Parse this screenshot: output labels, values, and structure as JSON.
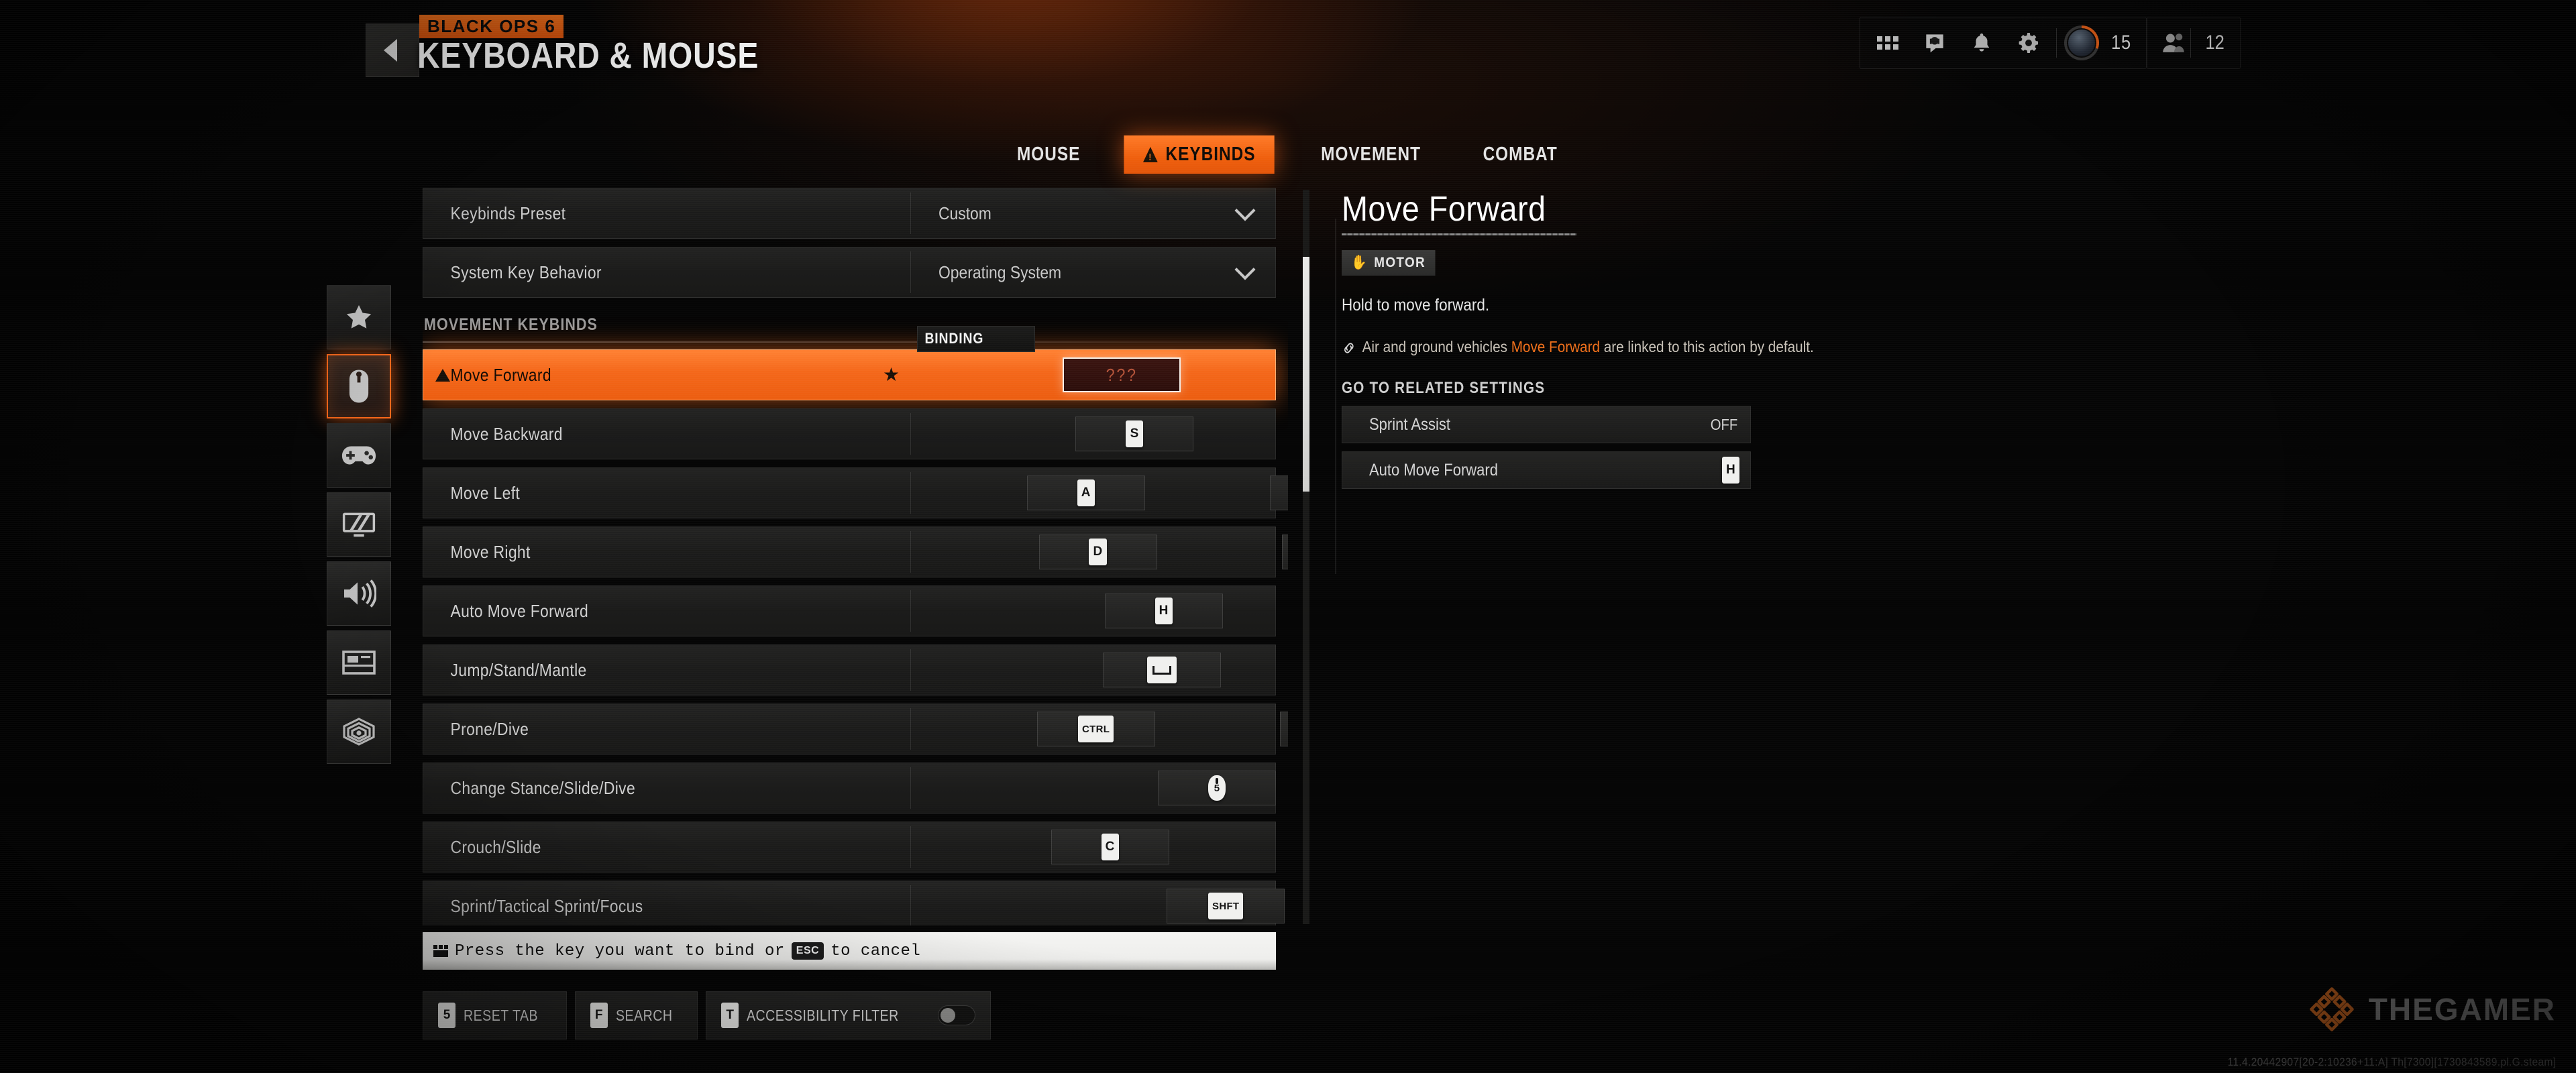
{
  "header": {
    "franchise_logo": "BLACK OPS 6",
    "title": "KEYBOARD & MOUSE",
    "back_icon": "chevron-left-icon"
  },
  "hud": {
    "icons": [
      "apps-grid-icon",
      "headset-icon",
      "bell-icon",
      "gear-icon"
    ],
    "level": "15",
    "friends_count": "12"
  },
  "tabs": [
    {
      "label": "MOUSE",
      "active": false,
      "warning": false
    },
    {
      "label": "KEYBINDS",
      "active": true,
      "warning": true
    },
    {
      "label": "MOVEMENT",
      "active": false,
      "warning": false
    },
    {
      "label": "COMBAT",
      "active": false,
      "warning": false
    }
  ],
  "sidebar": {
    "items": [
      {
        "name": "favorites",
        "icon": "star-icon",
        "active": false
      },
      {
        "name": "keyboard-mouse",
        "icon": "mouse-icon",
        "active": true
      },
      {
        "name": "controller",
        "icon": "gamepad-icon",
        "active": false
      },
      {
        "name": "graphics",
        "icon": "display-icon",
        "active": false
      },
      {
        "name": "audio",
        "icon": "speaker-icon",
        "active": false
      },
      {
        "name": "interface",
        "icon": "layout-icon",
        "active": false
      },
      {
        "name": "accessibility",
        "icon": "radar-icon",
        "active": false
      }
    ]
  },
  "settings_top": [
    {
      "label": "Keybinds Preset",
      "value": "Custom",
      "control": "dropdown"
    },
    {
      "label": "System Key Behavior",
      "value": "Operating System",
      "control": "dropdown"
    }
  ],
  "section_title": "MOVEMENT KEYBINDS",
  "binding_tooltip": "BINDING",
  "keybinds": [
    {
      "label": "Move Forward",
      "bind1": "???",
      "bind2": "",
      "selected": true,
      "warning": true,
      "favorite": true,
      "keytype1": "text"
    },
    {
      "label": "Move Backward",
      "bind1": "S",
      "bind2": "",
      "keytype1": "key"
    },
    {
      "label": "Move Left",
      "bind1": "A",
      "bind2": "",
      "keytype1": "key"
    },
    {
      "label": "Move Right",
      "bind1": "D",
      "bind2": "",
      "keytype1": "key"
    },
    {
      "label": "Auto Move Forward",
      "bind1": "H",
      "bind2": "",
      "keytype1": "key"
    },
    {
      "label": "Jump/Stand/Mantle",
      "bind1": "",
      "bind2": "",
      "keytype1": "space"
    },
    {
      "label": "Prone/Dive",
      "bind1": "CTRL",
      "bind2": "",
      "keytype1": "wide"
    },
    {
      "label": "Change Stance/Slide/Dive",
      "bind1": "5",
      "bind2": "",
      "keytype1": "mouse"
    },
    {
      "label": "Crouch/Slide",
      "bind1": "C",
      "bind2": "",
      "keytype1": "key"
    },
    {
      "label": "Sprint/Tactical Sprint/Focus",
      "bind1": "SHFT",
      "bind2": "",
      "keytype1": "wide"
    }
  ],
  "detail": {
    "title": "Move Forward",
    "tag": "MOTOR",
    "tag_icon": "hand-icon",
    "description": "Hold to move forward.",
    "link_icon": "link-icon",
    "link_prefix": "Air and ground vehicles ",
    "link_highlight": "Move Forward",
    "link_suffix": " are linked to this action by default.",
    "related_title": "GO TO RELATED SETTINGS",
    "related": [
      {
        "label": "Sprint Assist",
        "value": "OFF",
        "type": "text"
      },
      {
        "label": "Auto Move Forward",
        "value": "H",
        "type": "key"
      }
    ]
  },
  "prompt": {
    "icon": "keyboard-icon",
    "text_before": "Press the key you want to bind or",
    "key": "ESC",
    "text_after": "to cancel"
  },
  "footer_buttons": [
    {
      "key": "5",
      "label": "RESET TAB",
      "toggle": false
    },
    {
      "key": "F",
      "label": "SEARCH",
      "toggle": false
    },
    {
      "key": "T",
      "label": "ACCESSIBILITY FILTER",
      "toggle": true
    }
  ],
  "watermark": {
    "text": "THEGAMER",
    "icon": "thegamer-logo-icon"
  },
  "build_string": "11.4.20442907[20-2:10236+11:A] Th[7300][1730843589.pl.G.steam]",
  "colors": {
    "accent": "#f4701a",
    "accent_bright": "#ff7b29",
    "bg": "#050505",
    "row": "#1f1f1e"
  }
}
